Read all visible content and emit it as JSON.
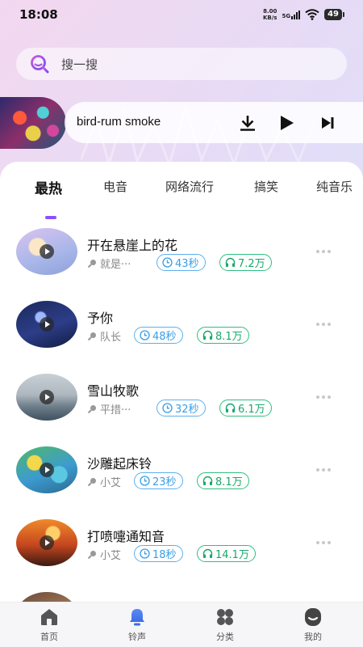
{
  "status_bar": {
    "time": "18:08",
    "net_speed_value": "8.00",
    "net_speed_unit": "KB/s",
    "signal_label": "5G",
    "battery": "49"
  },
  "search": {
    "placeholder": "搜一搜"
  },
  "player": {
    "title": "bird-rum smoke"
  },
  "tabs": [
    {
      "label": "最热",
      "active": true
    },
    {
      "label": "电音"
    },
    {
      "label": "网络流行"
    },
    {
      "label": "搞笑"
    },
    {
      "label": "纯音乐"
    }
  ],
  "songs": [
    {
      "title": "开在悬崖上的花",
      "artist": "就是···",
      "duration": "43秒",
      "plays": "7.2万"
    },
    {
      "title": "予你",
      "artist": "队长",
      "duration": "48秒",
      "plays": "8.1万"
    },
    {
      "title": "雪山牧歌",
      "artist": "平措···",
      "duration": "32秒",
      "plays": "6.1万"
    },
    {
      "title": "沙雕起床铃",
      "artist": "小艾",
      "duration": "23秒",
      "plays": "8.1万"
    },
    {
      "title": "打喷嚏通知音",
      "artist": "小艾",
      "duration": "18秒",
      "plays": "14.1万"
    }
  ],
  "bottom_nav": [
    {
      "label": "首页",
      "icon": "home-icon"
    },
    {
      "label": "铃声",
      "icon": "bell-icon",
      "active": true
    },
    {
      "label": "分类",
      "icon": "category-icon"
    },
    {
      "label": "我的",
      "icon": "profile-icon"
    }
  ],
  "colors": {
    "accent": "#8a50ff",
    "duration": "#3a9ee6",
    "plays": "#19a86a"
  }
}
